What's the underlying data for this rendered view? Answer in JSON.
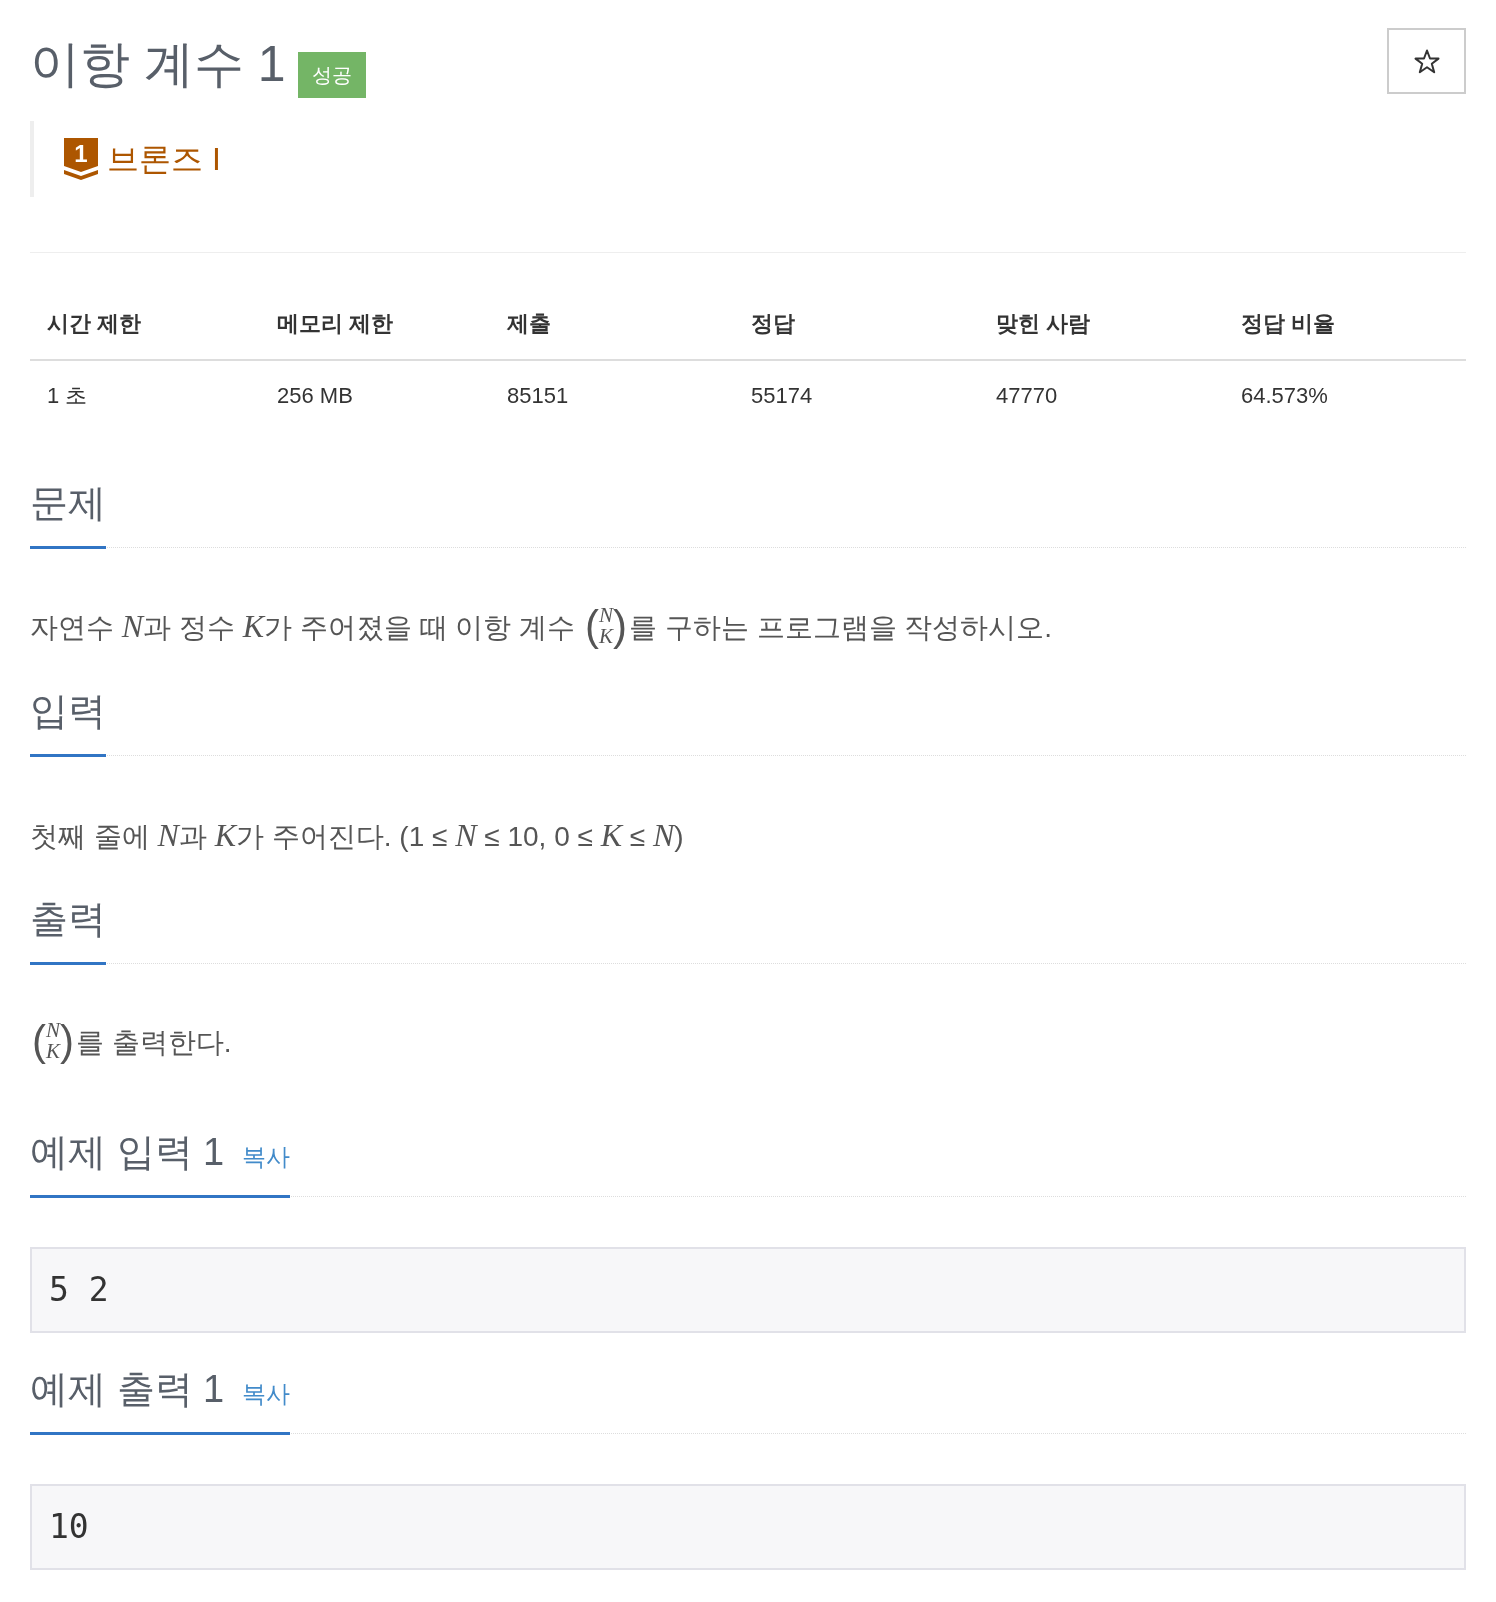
{
  "title": "이항 계수 1",
  "status_badge": "성공",
  "favorite": {
    "starred": false
  },
  "tier": {
    "number": "1",
    "label": "브론즈 I"
  },
  "table": {
    "columns": [
      "시간 제한",
      "메모리 제한",
      "제출",
      "정답",
      "맞힌 사람",
      "정답 비율"
    ],
    "rows": [
      [
        "1 초",
        "256 MB",
        "85151",
        "55174",
        "47770",
        "64.573%"
      ]
    ]
  },
  "sections": [
    {
      "heading": "문제",
      "paragraph": [
        {
          "kind": "text",
          "text": "자연수 "
        },
        {
          "kind": "var",
          "text": "N"
        },
        {
          "kind": "text",
          "text": "과 정수 "
        },
        {
          "kind": "var",
          "text": "K"
        },
        {
          "kind": "text",
          "text": "가 주어졌을 때 이항 계수 "
        },
        {
          "kind": "binom",
          "open": "(",
          "top": "N",
          "bottom": "K",
          "close": ")"
        },
        {
          "kind": "text",
          "text": "를 구하는 프로그램을 작성하시오."
        }
      ]
    },
    {
      "heading": "입력",
      "paragraph": [
        {
          "kind": "text",
          "text": "첫째 줄에 "
        },
        {
          "kind": "var",
          "text": "N"
        },
        {
          "kind": "text",
          "text": "과 "
        },
        {
          "kind": "var",
          "text": "K"
        },
        {
          "kind": "text",
          "text": "가 주어진다. (1 ≤ "
        },
        {
          "kind": "var",
          "text": "N"
        },
        {
          "kind": "text",
          "text": " ≤ 10, 0 ≤ "
        },
        {
          "kind": "var",
          "text": "K"
        },
        {
          "kind": "text",
          "text": " ≤ "
        },
        {
          "kind": "var",
          "text": "N"
        },
        {
          "kind": "text",
          "text": ")"
        }
      ]
    },
    {
      "heading": "출력",
      "paragraph": [
        {
          "kind": "binom",
          "open": "(",
          "top": "N",
          "bottom": "K",
          "close": ")"
        },
        {
          "kind": "text",
          "text": "를 출력한다."
        }
      ]
    }
  ],
  "samples": [
    {
      "heading": "예제 입력 1",
      "copy_link": "복사",
      "content": "5 2"
    },
    {
      "heading": "예제 출력 1",
      "copy_link": "복사",
      "content": "10"
    }
  ]
}
